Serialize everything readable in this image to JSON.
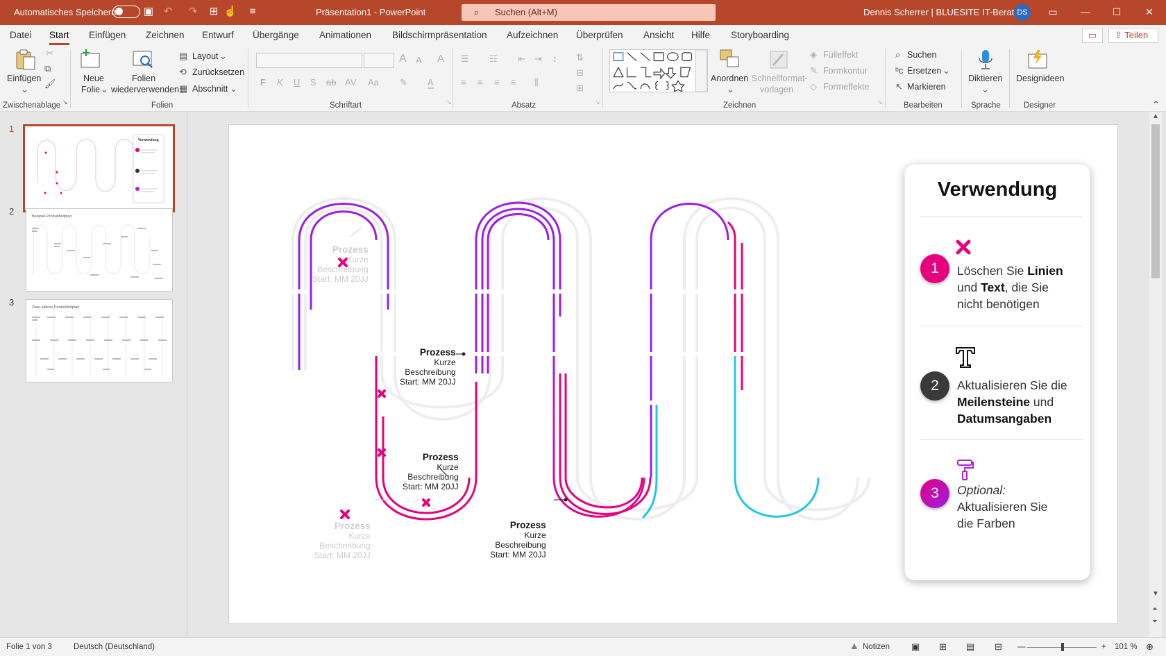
{
  "titlebar": {
    "autosave_label": "Automatisches Speichern",
    "doc_title": "Präsentation1  -  PowerPoint",
    "search_placeholder": "Suchen (Alt+M)",
    "user_name": "Dennis Scherrer | BLUESITE IT-Beratung",
    "avatar_initials": "DS"
  },
  "menu": {
    "tabs": [
      "Datei",
      "Start",
      "Einfügen",
      "Zeichnen",
      "Entwurf",
      "Übergänge",
      "Animationen",
      "Bildschirmpräsentation",
      "Aufzeichnen",
      "Überprüfen",
      "Ansicht",
      "Hilfe",
      "Storyboarding"
    ],
    "active_tab": "Start",
    "share_label": "Teilen"
  },
  "ribbon": {
    "clipboard": {
      "paste": "Einfügen",
      "group": "Zwischenablage"
    },
    "slides": {
      "new_slide_1": "Neue",
      "new_slide_2": "Folie",
      "reuse_1": "Folien",
      "reuse_2": "wiederverwenden",
      "layout": "Layout",
      "reset": "Zurücksetzen",
      "section": "Abschnitt",
      "group": "Folien"
    },
    "font": {
      "group": "Schriftart"
    },
    "paragraph": {
      "group": "Absatz"
    },
    "drawing": {
      "arrange": "Anordnen",
      "quick_styles_1": "Schnellformat-",
      "quick_styles_2": "vorlagen",
      "fill": "Fülleffekt",
      "outline": "Formkontur",
      "effects": "Formeffekte",
      "group": "Zeichnen"
    },
    "editing": {
      "find": "Suchen",
      "replace": "Ersetzen",
      "select": "Markieren",
      "group": "Bearbeiten"
    },
    "voice": {
      "dictate": "Diktieren",
      "group": "Sprache"
    },
    "designer": {
      "ideas": "Designideen",
      "group": "Designer"
    }
  },
  "thumbnails": [
    {
      "num": "1",
      "title": "Verwendung"
    },
    {
      "num": "2",
      "title": "Beispiel-Produktleitplan"
    },
    {
      "num": "3",
      "title": "Zwei-Jahres-Produktleitplan"
    }
  ],
  "slide": {
    "panel_title": "Verwendung",
    "step1_num": "1",
    "step1_a": "Löschen Sie ",
    "step1_b": "Linien",
    "step1_c": "und ",
    "step1_d": "Text",
    "step1_e": ", die Sie",
    "step1_f": "nicht benötigen",
    "step2_num": "2",
    "step2_a": "Aktualisieren Sie die",
    "step2_b": "Meilensteine",
    "step2_c": " und",
    "step2_d": "Datumsangaben",
    "step3_num": "3",
    "step3_a": "Optional:",
    "step3_b": "Aktualisieren Sie",
    "step3_c": "die Farben",
    "labels": [
      {
        "title": "Prozess",
        "l1": "Kurze",
        "l2": "Beschreibung",
        "l3": "Start: MM 20JJ"
      }
    ]
  },
  "status": {
    "slide_of": "Folie 1 von 3",
    "language": "Deutsch (Deutschland)",
    "notes": "Notizen",
    "zoom": "101 %"
  },
  "colors": {
    "accent": "#b7472a",
    "magenta": "#e6007e",
    "purple": "#9b1ee6",
    "cyan": "#1cc8e6"
  }
}
